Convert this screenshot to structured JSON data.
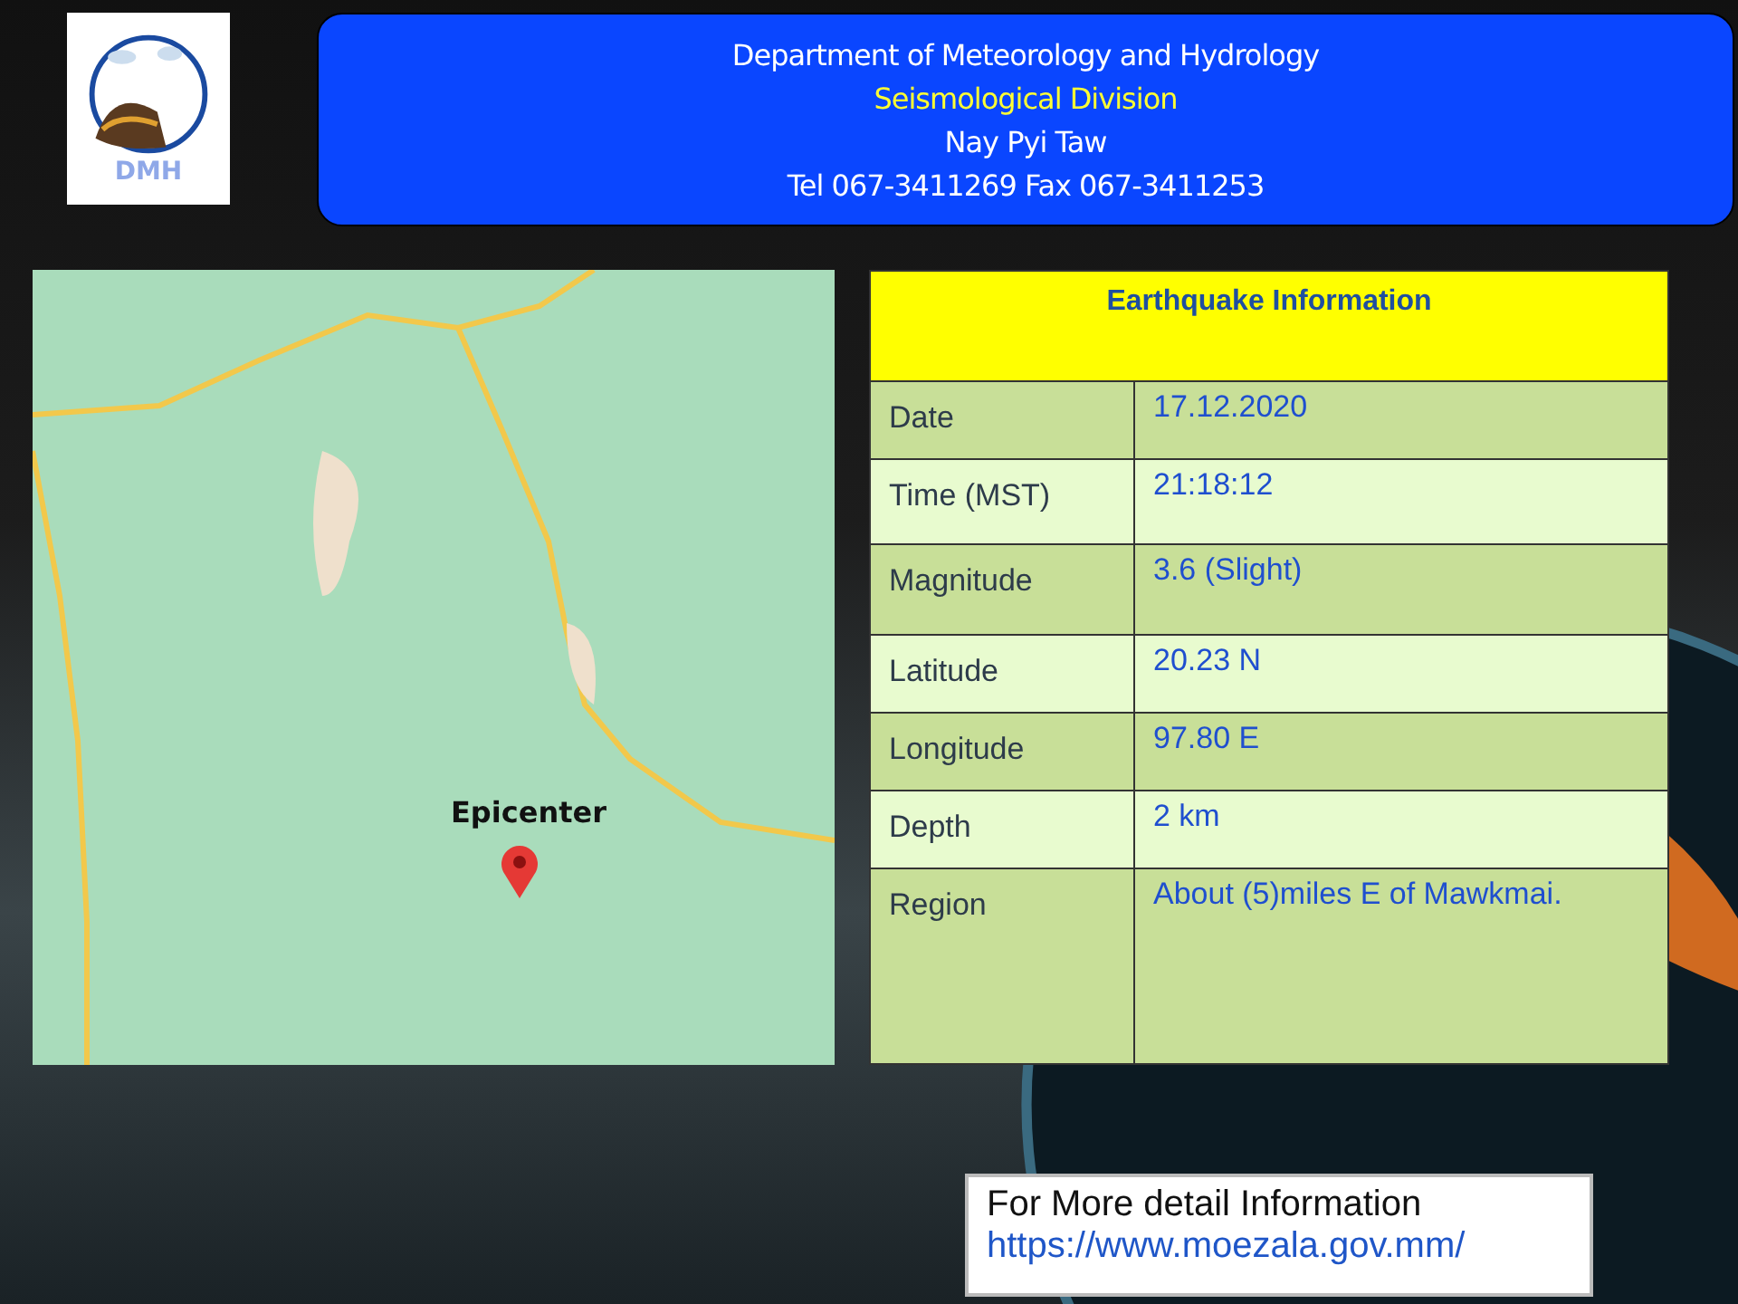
{
  "header": {
    "logo_text": "DMH",
    "lines": [
      {
        "text": "Department of Meteorology and Hydrology",
        "kind": "plain"
      },
      {
        "text": "Seismological Division",
        "kind": "highlight"
      },
      {
        "text": "Nay Pyi Taw",
        "kind": "plain"
      },
      {
        "text": "Tel 067-3411269 Fax 067-3411253",
        "kind": "plain"
      }
    ]
  },
  "map": {
    "marker_label": "Epicenter"
  },
  "info_table": {
    "title": "Earthquake Information",
    "rows": [
      {
        "label": "Date",
        "value": "17.12.2020"
      },
      {
        "label": "Time (MST)",
        "value": "21:18:12"
      },
      {
        "label": "Magnitude",
        "value": "3.6 (Slight)"
      },
      {
        "label": "Latitude",
        "value": "20.23 N"
      },
      {
        "label": "Longitude",
        "value": "97.80 E"
      },
      {
        "label": "Depth",
        "value": "2 km"
      },
      {
        "label": "Region",
        "value": "About (5)miles E of Mawkmai."
      }
    ]
  },
  "more_info": {
    "label": "For More detail Information",
    "link": "https://www.moezala.gov.mm/"
  }
}
